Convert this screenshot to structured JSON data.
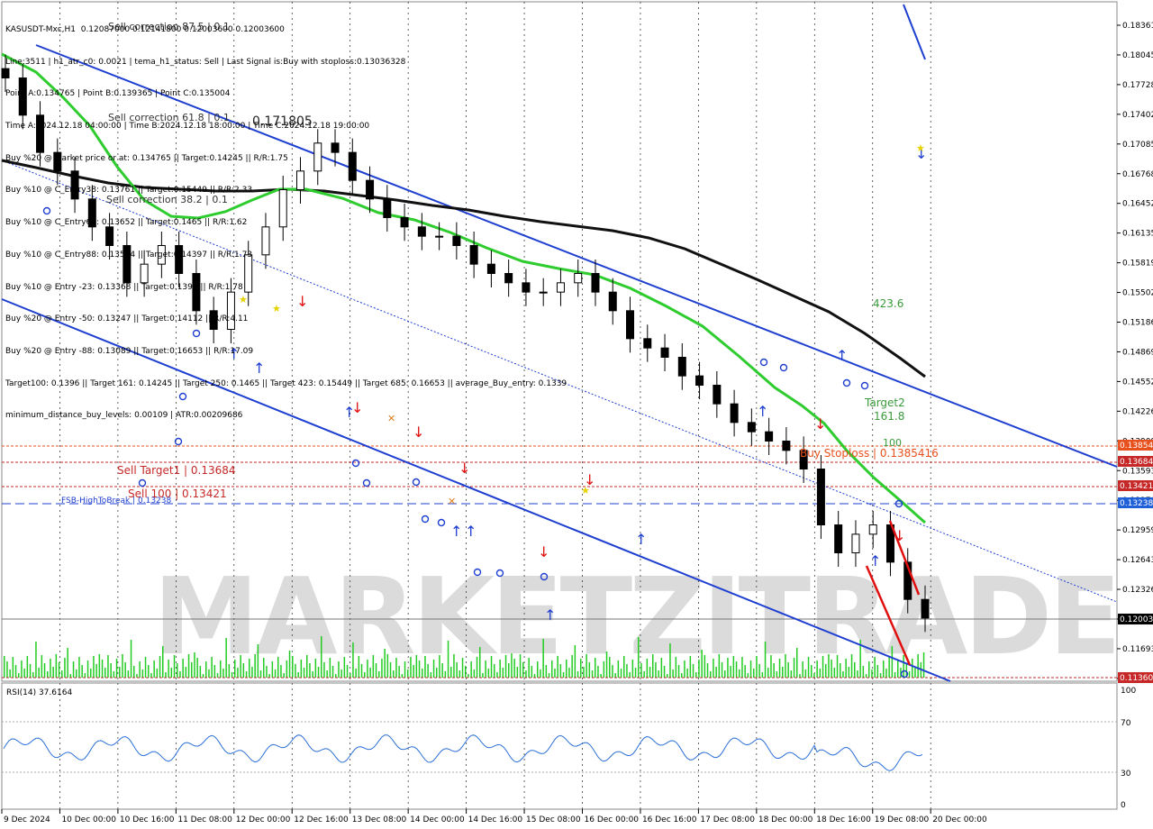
{
  "header": {
    "lines": [
      "KASUSDT-Mxc,H1  0.12087000 0.12141800 0.12003600 0.12003600",
      "Line:3511 | h1_atr_c0: 0.0021 | tema_h1_status: Sell | Last Signal is:Buy with stoploss:0.13036328",
      "Point A:0.134765 | Point B:0.139365 | Point C:0.135004",
      "Time A:2024.12.18 04:00:00 | Time B:2024.12.18 18:00:00 | Time C:2024.12.18 19:00:00",
      "Buy %20 @ Market price or at: 0.134765 || Target:0.14245 || R/R:1.75",
      "Buy %10 @ C_Entry38: 0.13761 || Target:0.15449 || R/R:2.33",
      "Buy %10 @ C_Entry61: 0.13652 || Target:0.1465 || R/R:1.62",
      "Buy %10 @ C_Entry88: 0.13534 || Target:0.14397 || R/R:1.73",
      "Buy %10 @ Entry -23: 0.13368 || Target:0.1396 || R/R:1.78",
      "Buy %20 @ Entry -50: 0.13247 || Target:0.14112 || R/R:4.11",
      "Buy %20 @ Entry -88: 0.13089 || Target:0.16653 || R/R:17.09",
      "Target100: 0.1396 || Target 161: 0.14245 || Target 250: 0.1465 || Target 423: 0.15449 || Target 685: 0.16653 || average_Buy_entry: 0.1339",
      "minimum_distance_buy_levels: 0.00109 | ATR:0.00209686"
    ]
  },
  "overlay_labels": {
    "sell_correction_618": "Sell correction 61.8 | 0.1",
    "sell_correction_875": "Sell correction 87.5 | 0.1",
    "price_171805": "0.171805",
    "sell_correction_382": "Sell correction 38.2 | 0.1",
    "sell_target1": "Sell Target1 | 0.13684",
    "sell_100": "Sell 100 | 0.13421",
    "fsb": "FSB-HighToBreak | 0.13238",
    "buy_stoploss": "Buy Stoploss | 0.1385416",
    "fib_423": "423.6",
    "target2": "Target2",
    "fib_1618": "161.8",
    "fib_100": "100",
    "watermark": "MARKETZITRADE"
  },
  "price_axis": {
    "ticks": [
      "0.18361",
      "0.18045",
      "0.17728",
      "0.17402",
      "0.17085",
      "0.16768",
      "0.16452",
      "0.16135",
      "0.15819",
      "0.15502",
      "0.15186",
      "0.14869",
      "0.14552",
      "0.14226",
      "0.13909",
      "0.13593",
      "0.13276",
      "0.12959",
      "0.12643",
      "0.12326",
      "0.12009",
      "0.11693",
      "0.11360"
    ],
    "highlights": [
      {
        "label": "0.13854",
        "color": "#e8501e"
      },
      {
        "label": "0.13684",
        "color": "#c62828"
      },
      {
        "label": "0.13421",
        "color": "#c62828"
      },
      {
        "label": "0.13238",
        "color": "#1f5fd8"
      },
      {
        "label": "0.12003",
        "color": "#000000"
      },
      {
        "label": "0.11360",
        "color": "#c62828"
      }
    ]
  },
  "time_axis": {
    "labels": [
      "9 Dec 2024",
      "10 Dec 00:00",
      "10 Dec 16:00",
      "11 Dec 08:00",
      "12 Dec 00:00",
      "12 Dec 16:00",
      "13 Dec 08:00",
      "14 Dec 00:00",
      "14 Dec 16:00",
      "15 Dec 08:00",
      "16 Dec 00:00",
      "16 Dec 16:00",
      "17 Dec 08:00",
      "18 Dec 00:00",
      "18 Dec 16:00",
      "19 Dec 08:00",
      "20 Dec 00:00"
    ]
  },
  "rsi": {
    "label": "RSI(14) 37.6164",
    "levels": [
      "100",
      "70",
      "30",
      "0"
    ]
  },
  "colors": {
    "up_bar": "#000000",
    "channel": "#1f3fd0",
    "ma_fast": "#2ecc2e",
    "ma_slow": "#111111",
    "sell_level": "#d32f2f",
    "fsb_level": "#1f3fd0",
    "rsi_line": "#2a6fd6",
    "volume": "#22cc22",
    "watermark": "#c9c9c9"
  },
  "chart_data": {
    "type": "candlestick",
    "symbol": "KASUSDT-Mxc",
    "timeframe": "H1",
    "ylim": [
      0.1136,
      0.1854
    ],
    "ohlc_last": {
      "open": 0.12087,
      "high": 0.121418,
      "low": 0.120036,
      "close": 0.120036
    },
    "close_approx": [
      0.178,
      0.174,
      0.17,
      0.168,
      0.165,
      0.162,
      0.16,
      0.156,
      0.158,
      0.16,
      0.157,
      0.153,
      0.151,
      0.155,
      0.159,
      0.162,
      0.166,
      0.168,
      0.171,
      0.17,
      0.167,
      0.165,
      0.163,
      0.162,
      0.161,
      0.161,
      0.16,
      0.158,
      0.157,
      0.156,
      0.155,
      0.155,
      0.156,
      0.157,
      0.155,
      0.153,
      0.15,
      0.149,
      0.148,
      0.146,
      0.145,
      0.143,
      0.141,
      0.14,
      0.139,
      0.138,
      0.136,
      0.13,
      0.127,
      0.129,
      0.13,
      0.126,
      0.122,
      0.12
    ],
    "horizontal_levels": [
      {
        "name": "Buy Stoploss",
        "value": 0.1385416
      },
      {
        "name": "Sell Target1",
        "value": 0.13684
      },
      {
        "name": "Sell 100",
        "value": 0.13421
      },
      {
        "name": "FSB-HighToBreak",
        "value": 0.13238
      }
    ],
    "rsi": {
      "name": "RSI(14)",
      "last": 37.6164,
      "levels": [
        70,
        30
      ],
      "ylim": [
        0,
        100
      ]
    }
  }
}
